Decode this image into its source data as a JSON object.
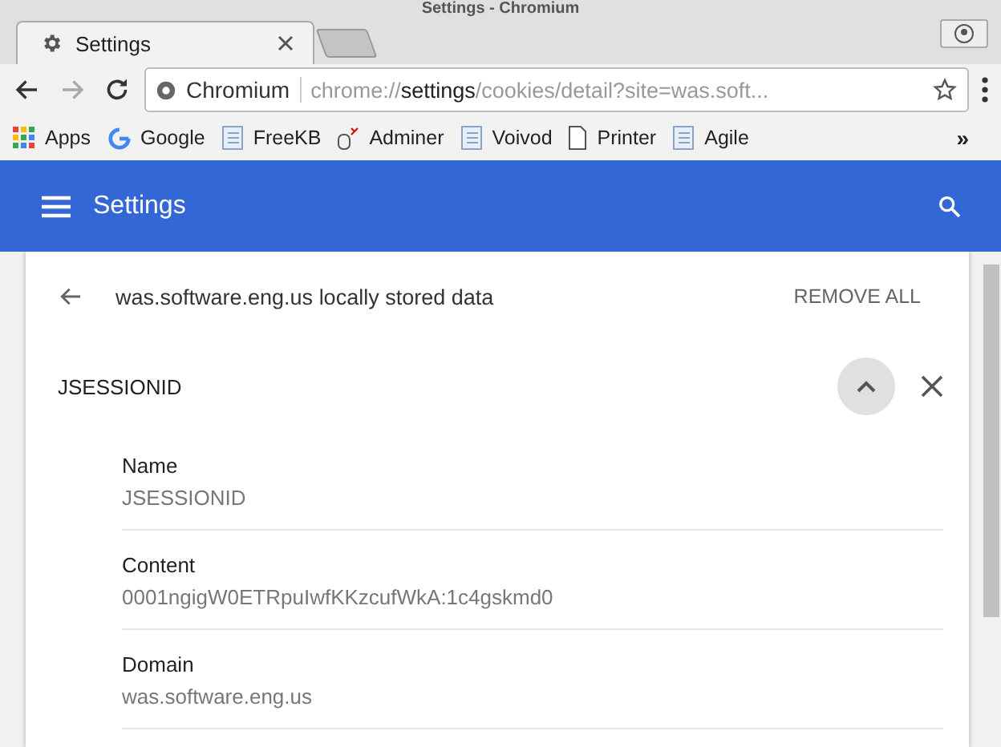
{
  "window": {
    "title": "Settings - Chromium"
  },
  "tabs": [
    {
      "label": "Settings",
      "selected": true
    }
  ],
  "address_bar": {
    "site_label": "Chromium",
    "url_scheme": "chrome://",
    "url_host": "settings",
    "url_path": "/cookies/detail?site=was.soft..."
  },
  "bookmarks": [
    {
      "label": "Apps",
      "kind": "apps"
    },
    {
      "label": "Google",
      "kind": "google"
    },
    {
      "label": "FreeKB",
      "kind": "page"
    },
    {
      "label": "Adminer",
      "kind": "db"
    },
    {
      "label": "Voivod",
      "kind": "page"
    },
    {
      "label": "Printer",
      "kind": "file"
    },
    {
      "label": "Agile",
      "kind": "page"
    }
  ],
  "bookmarks_overflow": "»",
  "header": {
    "title": "Settings"
  },
  "page": {
    "title": "was.software.eng.us locally stored data",
    "remove_all": "REMOVE ALL"
  },
  "cookie": {
    "name": "JSESSIONID",
    "expanded": true,
    "fields": [
      {
        "label": "Name",
        "value": "JSESSIONID"
      },
      {
        "label": "Content",
        "value": "0001ngigW0ETRpuIwfKKzcufWkA:1c4gskmd0"
      },
      {
        "label": "Domain",
        "value": "was.software.eng.us"
      }
    ]
  }
}
